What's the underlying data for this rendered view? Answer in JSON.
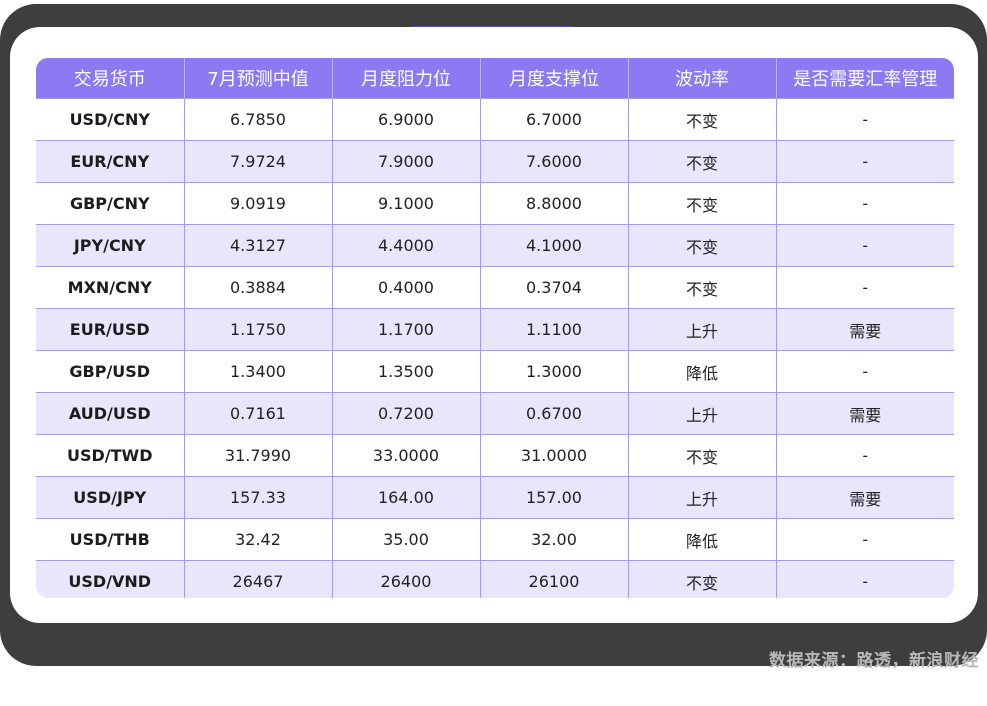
{
  "table": {
    "headers": [
      "交易货币",
      "7月预测中值",
      "月度阻力位",
      "月度支撑位",
      "波动率",
      "是否需要汇率管理"
    ],
    "rows": [
      [
        "USD/CNY",
        "6.7850",
        "6.9000",
        "6.7000",
        "不变",
        "-"
      ],
      [
        "EUR/CNY",
        "7.9724",
        "7.9000",
        "7.6000",
        "不变",
        "-"
      ],
      [
        "GBP/CNY",
        "9.0919",
        "9.1000",
        "8.8000",
        "不变",
        "-"
      ],
      [
        "JPY/CNY",
        "4.3127",
        "4.4000",
        "4.1000",
        "不变",
        "-"
      ],
      [
        "MXN/CNY",
        "0.3884",
        "0.4000",
        "0.3704",
        "不变",
        "-"
      ],
      [
        "EUR/USD",
        "1.1750",
        "1.1700",
        "1.1100",
        "上升",
        "需要"
      ],
      [
        "GBP/USD",
        "1.3400",
        "1.3500",
        "1.3000",
        "降低",
        "-"
      ],
      [
        "AUD/USD",
        "0.7161",
        "0.7200",
        "0.6700",
        "上升",
        "需要"
      ],
      [
        "USD/TWD",
        "31.7990",
        "33.0000",
        "31.0000",
        "不变",
        "-"
      ],
      [
        "USD/JPY",
        "157.33",
        "164.00",
        "157.00",
        "上升",
        "需要"
      ],
      [
        "USD/THB",
        "32.42",
        "35.00",
        "32.00",
        "降低",
        "-"
      ],
      [
        "USD/VND",
        "26467",
        "26400",
        "26100",
        "不变",
        "-"
      ]
    ]
  },
  "footer": {
    "source": "数据来源：路透，新浪财经"
  },
  "colors": {
    "header_bg": "#8d7af2",
    "stripe_bg": "#e9e6fb",
    "frame_bg": "#3e3e3e"
  }
}
